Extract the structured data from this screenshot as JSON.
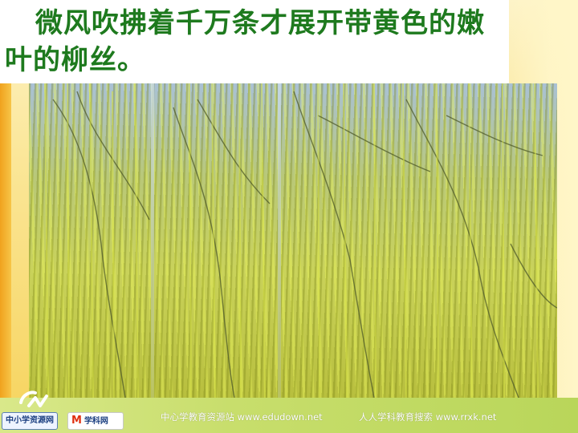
{
  "slide": {
    "heading": "微风吹拂着千万条才展开带黄色的嫩叶的柳丝。"
  },
  "footer": {
    "site_left": "中心学教育资源站 www.edudown.net",
    "site_right": "人人学科教育搜索 www.rrxk.net",
    "badge_left": "中小学资源网",
    "badge_right_mark": "M",
    "badge_right": "学科网"
  },
  "photo": {
    "subject": "willow branches with new yellow leaves"
  },
  "colors": {
    "heading": "#1e7a1e",
    "background": "#fbe79a",
    "stripe": "#f0a21e"
  }
}
